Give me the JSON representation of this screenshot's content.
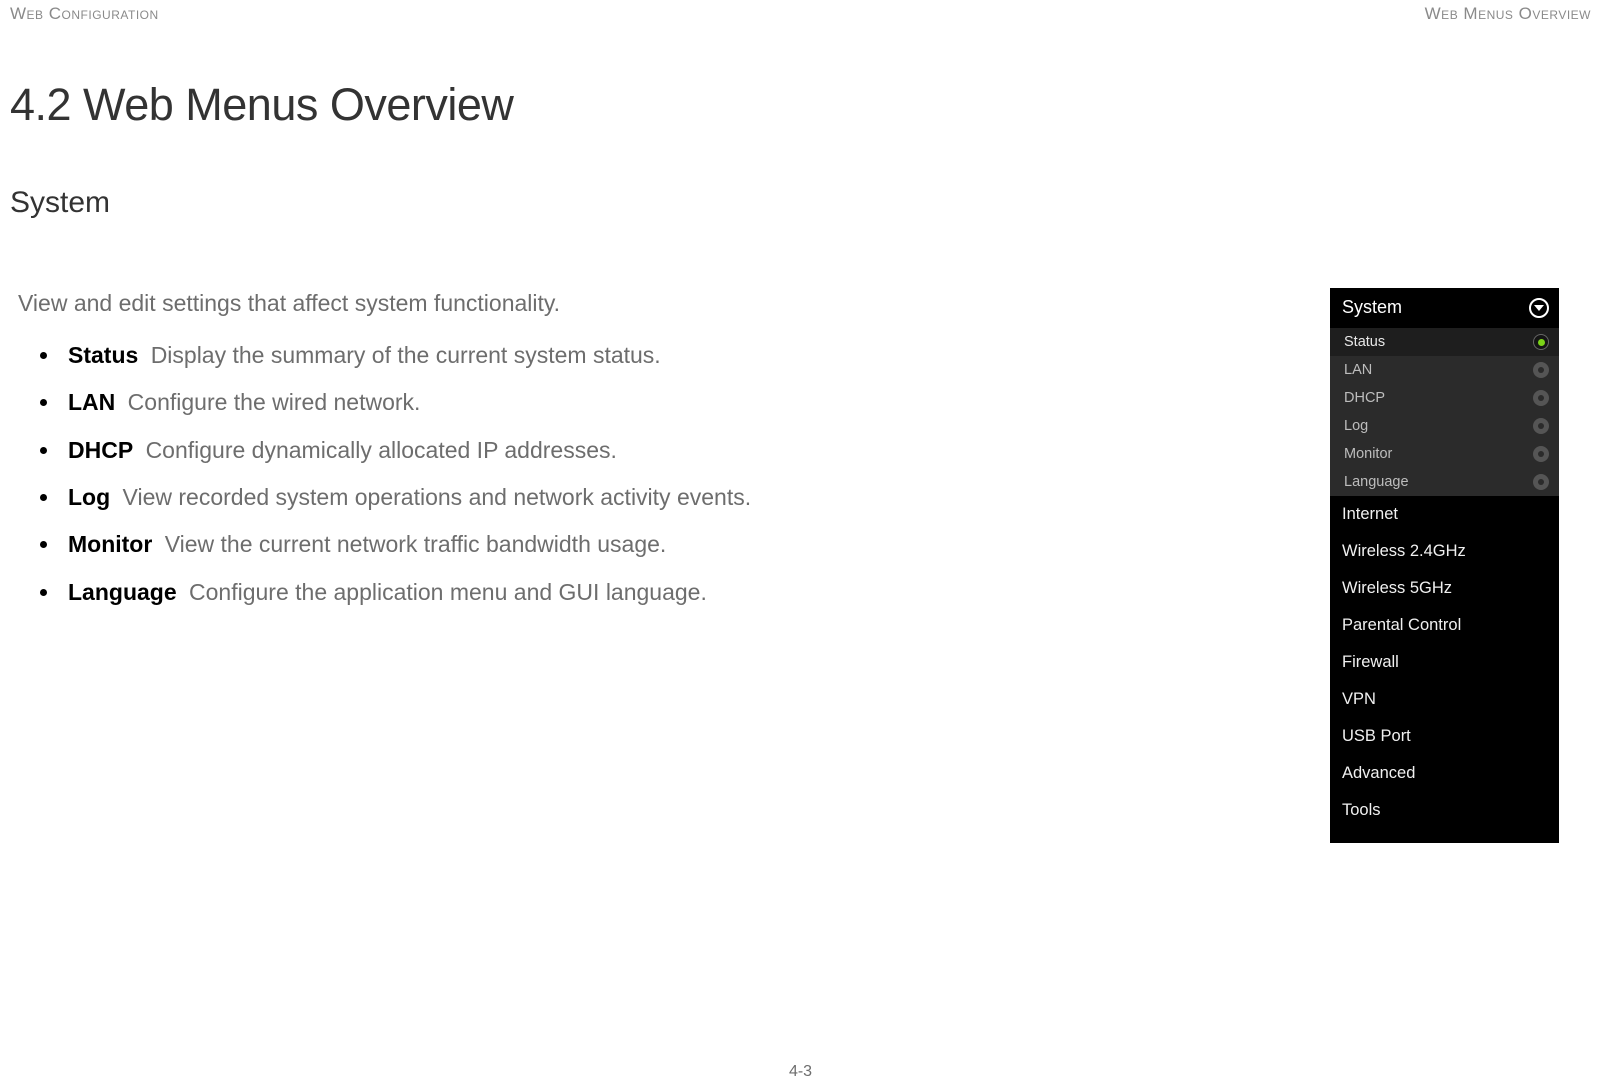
{
  "header": {
    "left": "Web Configuration",
    "right": "Web Menus Overview"
  },
  "page_title": "4.2 Web Menus Overview",
  "section_title": "System",
  "intro": "View and edit settings that affect system functionality.",
  "items": [
    {
      "term": "Status",
      "desc": "Display the summary of the current system status."
    },
    {
      "term": "LAN",
      "desc": "Configure the wired network."
    },
    {
      "term": "DHCP",
      "desc": "Configure dynamically allocated IP addresses."
    },
    {
      "term": "Log",
      "desc": "View recorded system operations and network activity events."
    },
    {
      "term": "Monitor",
      "desc": "View the current network traffic bandwidth usage."
    },
    {
      "term": "Language",
      "desc": "Configure the application menu and GUI language."
    }
  ],
  "menu": {
    "expanded_header": "System",
    "sub_items": [
      "Status",
      "LAN",
      "DHCP",
      "Log",
      "Monitor",
      "Language"
    ],
    "active_sub_index": 0,
    "main_items": [
      "Internet",
      "Wireless 2.4GHz",
      "Wireless 5GHz",
      "Parental Control",
      "Firewall",
      "VPN",
      "USB Port",
      "Advanced",
      "Tools"
    ]
  },
  "footer": "4-3"
}
